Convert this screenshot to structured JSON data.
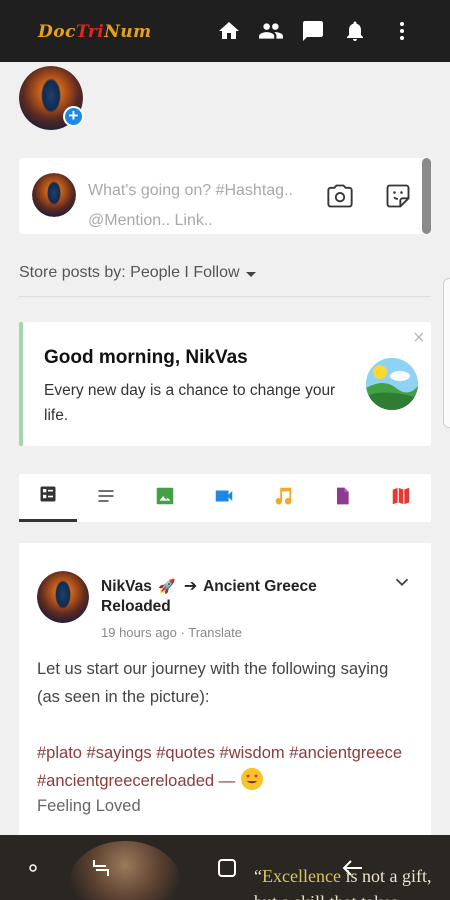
{
  "app": {
    "logo_part1": "Doc",
    "logo_part2": "Tri",
    "logo_part3": "Num"
  },
  "top_nav": {
    "icons": [
      "home-icon",
      "people-icon",
      "chat-icon",
      "bell-icon",
      "more-vert-icon"
    ]
  },
  "composer": {
    "placeholder": "What's going on? #Hashtag.. @Mention.. Link..",
    "icons": [
      "camera-icon",
      "sticker-icon"
    ]
  },
  "store_posts": {
    "label": "Store posts by: People I Follow"
  },
  "greeting": {
    "title": "Good morning, NikVas",
    "message": "Every new day is a chance to change your life.",
    "close": "×"
  },
  "filter_tabs": [
    {
      "name": "all",
      "icon": "feed-icon",
      "color": "#333333"
    },
    {
      "name": "text",
      "icon": "text-lines-icon",
      "color": "#555555"
    },
    {
      "name": "photos",
      "icon": "image-icon",
      "color": "#43a047"
    },
    {
      "name": "videos",
      "icon": "video-icon",
      "color": "#1e88e5"
    },
    {
      "name": "music",
      "icon": "music-icon",
      "color": "#f5a623"
    },
    {
      "name": "files",
      "icon": "file-icon",
      "color": "#8e3a8e"
    },
    {
      "name": "maps",
      "icon": "map-icon",
      "color": "#e53935"
    }
  ],
  "post": {
    "author": "NikVas",
    "arrow": "➔",
    "group": "Ancient Greece Reloaded",
    "time": "19 hours ago",
    "translate": "Translate",
    "body": "Let us start our journey with the following saying (as seen in the picture):",
    "hashtags": "#plato #sayings #quotes #wisdom #ancientgreece #ancientgreecereloaded —",
    "feeling": "Feeling Loved"
  },
  "overlay": {
    "quote_line1_a": "“",
    "quote_line1_hl": "Excellence",
    "quote_line1_b": " is not a gift,",
    "quote_line2": "but a skill that takes practice"
  }
}
